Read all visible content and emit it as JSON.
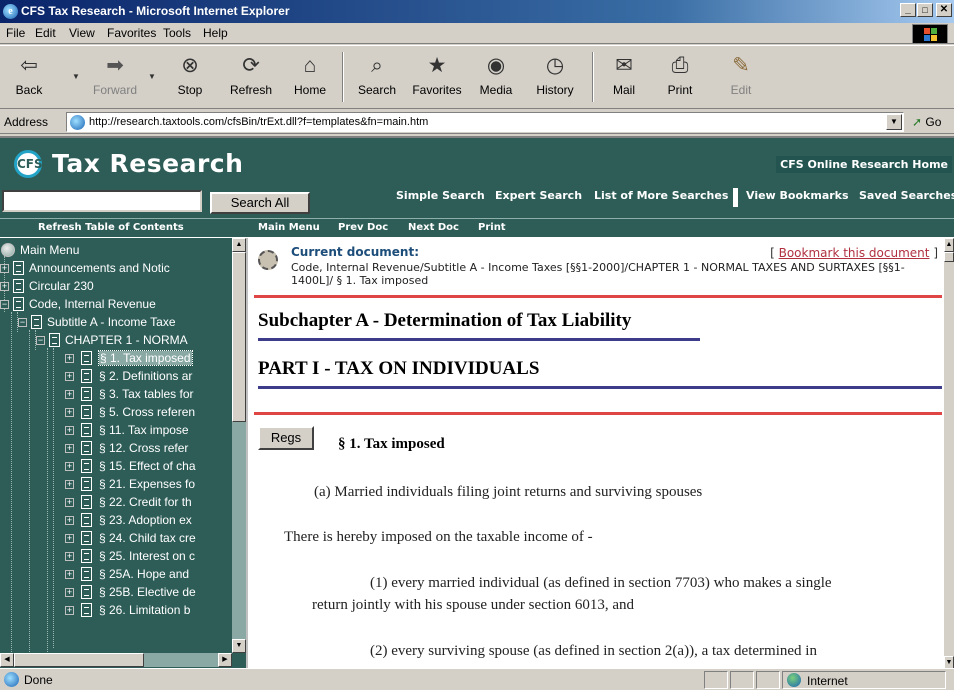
{
  "window": {
    "title": "CFS Tax Research - Microsoft Internet Explorer",
    "controls": [
      "_",
      "□",
      "✕"
    ]
  },
  "menu": [
    "File",
    "Edit",
    "View",
    "Favorites",
    "Tools",
    "Help"
  ],
  "toolbar": {
    "buttons": [
      {
        "label": "Back",
        "icon": "back-arrow-icon"
      },
      {
        "label": "Forward",
        "icon": "forward-arrow-icon"
      },
      {
        "label": "Stop",
        "icon": "stop-icon"
      },
      {
        "label": "Refresh",
        "icon": "refresh-icon"
      },
      {
        "label": "Home",
        "icon": "home-icon"
      },
      {
        "label": "Search",
        "icon": "search-icon"
      },
      {
        "label": "Favorites",
        "icon": "favorites-icon"
      },
      {
        "label": "Media",
        "icon": "media-icon"
      },
      {
        "label": "History",
        "icon": "history-icon"
      },
      {
        "label": "Mail",
        "icon": "mail-icon"
      },
      {
        "label": "Print",
        "icon": "print-icon"
      },
      {
        "label": "Edit",
        "icon": "edit-icon"
      }
    ]
  },
  "address": {
    "label": "Address",
    "url": "http://research.taxtools.com/cfsBin/trExt.dll?f=templates&fn=main.htm",
    "go_label": "Go"
  },
  "banner": {
    "logo_text": "CFS",
    "brand": "Tax Research",
    "home_link": "CFS Online Research Home",
    "search_button": "Search All",
    "search_links": [
      "Simple Search",
      "Expert Search",
      "List of More Searches",
      "View Bookmarks",
      "Saved Searches"
    ]
  },
  "nav": {
    "refresh_toc": "Refresh Table of Contents",
    "links": [
      "Main Menu",
      "Prev Doc",
      "Next Doc",
      "Print"
    ]
  },
  "toc": [
    {
      "label": "Main Menu",
      "level": 0,
      "type": "root"
    },
    {
      "label": "Announcements and Notic",
      "level": 0,
      "type": "collapsed"
    },
    {
      "label": "Circular 230",
      "level": 0,
      "type": "collapsed"
    },
    {
      "label": "Code, Internal Revenue",
      "level": 0,
      "type": "expanded"
    },
    {
      "label": "Subtitle A - Income Taxe",
      "level": 1,
      "type": "expanded"
    },
    {
      "label": "CHAPTER 1 - NORMA",
      "level": 2,
      "type": "expanded"
    },
    {
      "label": "§ 1. Tax imposed",
      "level": 3,
      "type": "collapsed",
      "selected": true
    },
    {
      "label": "§ 2. Definitions ar",
      "level": 3,
      "type": "collapsed"
    },
    {
      "label": "§ 3. Tax tables for",
      "level": 3,
      "type": "collapsed"
    },
    {
      "label": "§ 5. Cross referen",
      "level": 3,
      "type": "collapsed"
    },
    {
      "label": "§ 11. Tax impose",
      "level": 3,
      "type": "collapsed"
    },
    {
      "label": "§ 12. Cross refer",
      "level": 3,
      "type": "collapsed"
    },
    {
      "label": "§ 15. Effect of cha",
      "level": 3,
      "type": "collapsed"
    },
    {
      "label": "§ 21. Expenses fo",
      "level": 3,
      "type": "collapsed"
    },
    {
      "label": "§ 22. Credit for th",
      "level": 3,
      "type": "collapsed"
    },
    {
      "label": "§ 23. Adoption ex",
      "level": 3,
      "type": "collapsed"
    },
    {
      "label": "§ 24. Child tax cre",
      "level": 3,
      "type": "collapsed"
    },
    {
      "label": "§ 25. Interest on c",
      "level": 3,
      "type": "collapsed"
    },
    {
      "label": "§ 25A. Hope and",
      "level": 3,
      "type": "collapsed"
    },
    {
      "label": "§ 25B. Elective de",
      "level": 3,
      "type": "collapsed"
    },
    {
      "label": "§ 26. Limitation b",
      "level": 3,
      "type": "collapsed"
    }
  ],
  "document": {
    "current_label": "Current document:",
    "bookmark_open": "[",
    "bookmark_link": "Bookmark this document",
    "bookmark_close": "]",
    "path": "Code, Internal Revenue/Subtitle A - Income Taxes [§§1-2000]/CHAPTER 1 - NORMAL TAXES AND SURTAXES [§§1-1400L]/ § 1. Tax imposed",
    "subchapter": "Subchapter A - Determination of Tax Liability",
    "part": "PART I - TAX ON INDIVIDUALS",
    "regs_button": "Regs",
    "section_title": "§ 1. Tax imposed",
    "para_a": "(a) Married individuals filing joint returns and surviving spouses",
    "para_imposed": "There is hereby imposed on the taxable income of -",
    "para_1_line1": "(1) every married individual (as defined in section 7703) who makes a single",
    "para_1_line2": "return jointly with his spouse under section 6013, and",
    "para_2_line1": "(2) every surviving spouse (as defined in section 2(a)), a tax determined in"
  },
  "status": {
    "text": "Done",
    "zone": "Internet"
  },
  "colors": {
    "banner": "#2e5d58",
    "accent_red": "#e04545",
    "heading_rule": "#3c3c8a",
    "link_red": "#b03040",
    "title_bar": "#0a246a"
  }
}
